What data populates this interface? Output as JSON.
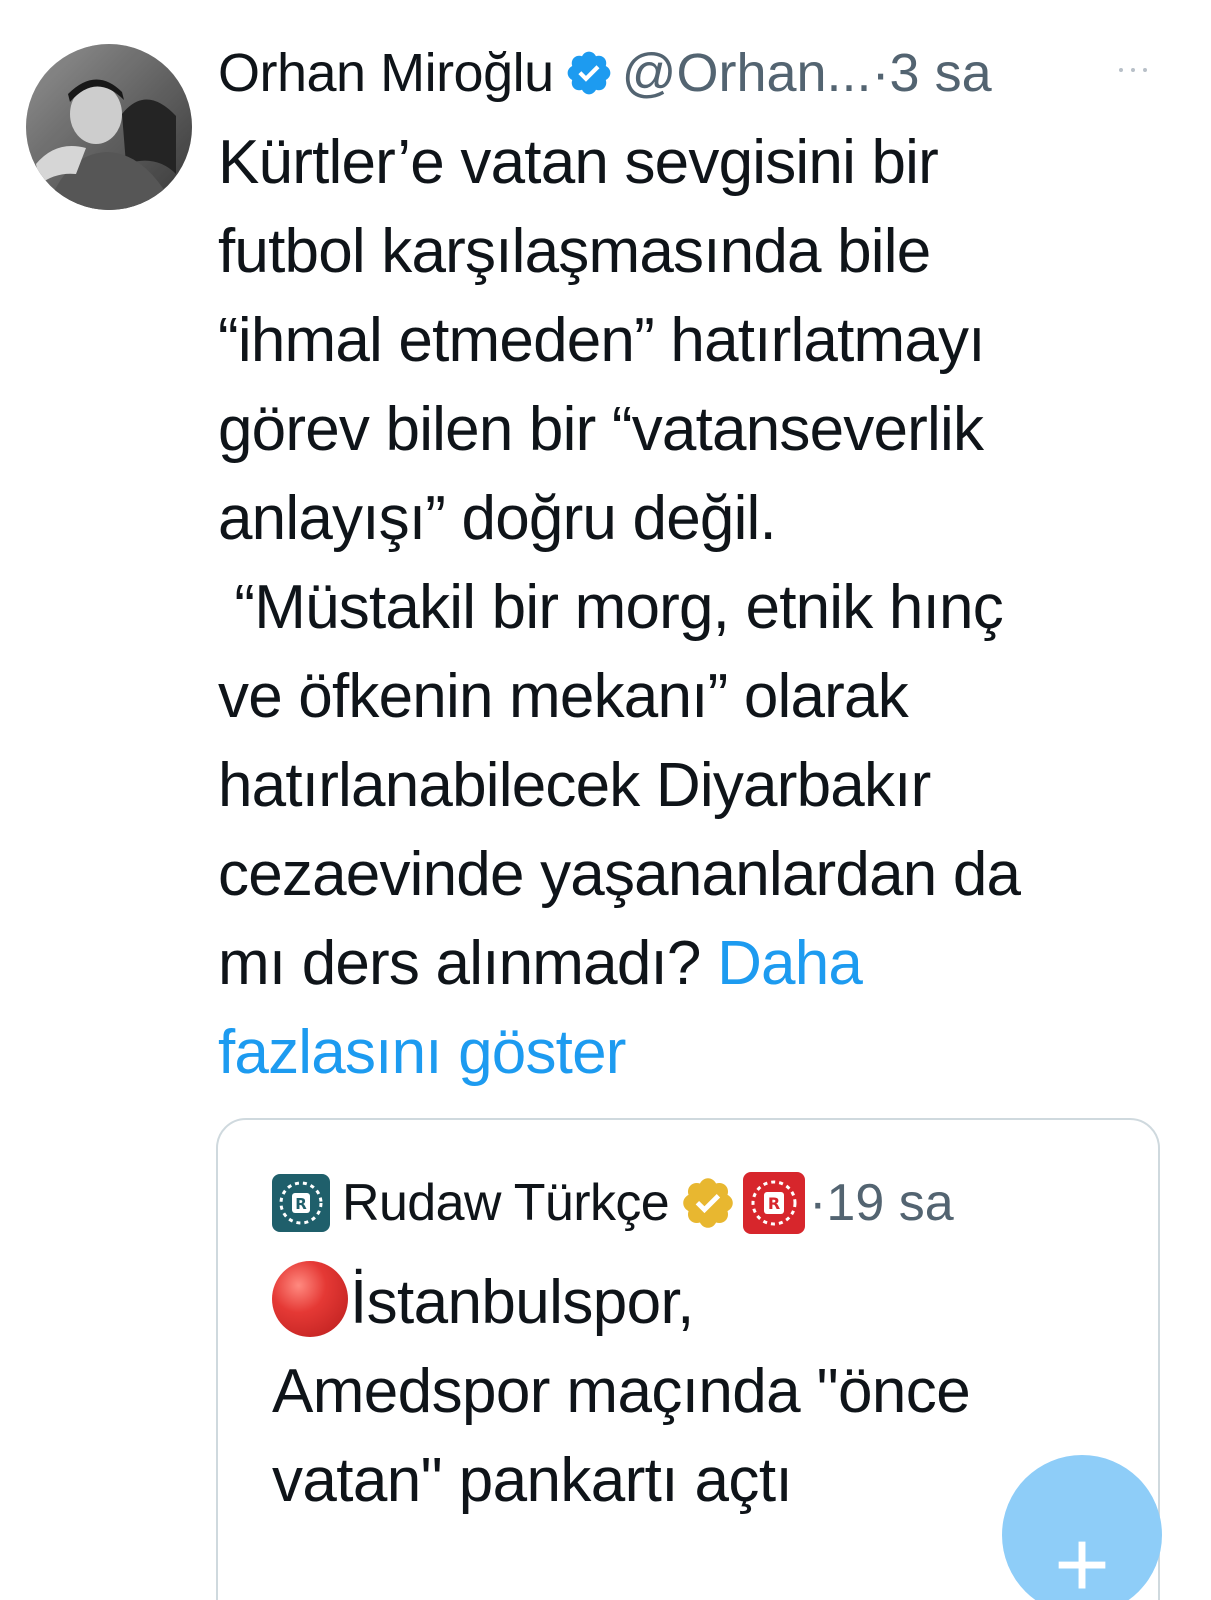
{
  "tweet": {
    "author_name": "Orhan Miroğlu",
    "handle": "@Orhan...",
    "separator": "·",
    "time": "3 sa",
    "lines": [
      "Kürtler’e vatan sevgisini bir",
      "futbol karşılaşmasında bile",
      "“ihmal etmeden” hatırlatmayı",
      "görev bilen bir “vatanseverlik",
      "anlayışı” doğru değil.",
      " “Müstakil bir morg, etnik hınç",
      "ve öfkenin mekanı” olarak",
      "hatırlanabilecek Diyarbakır",
      "cezaevinde yaşananlardan da",
      "mı ders alınmadı?"
    ],
    "show_more_part1": "Daha",
    "show_more_part2": "fazlasını göster"
  },
  "quoted_tweet": {
    "author_name": "Rudaw Türkçe",
    "separator": "·",
    "time": "19 sa",
    "lines": [
      "İstanbulspor,",
      "Amedspor maçında \"önce",
      "vatan\" pankartı açtı"
    ]
  },
  "fab": {
    "label": "+"
  },
  "colors": {
    "text": "#0f1419",
    "secondary": "#536471",
    "link": "#1d9bf0",
    "verified_blue": "#1d9bf0",
    "verified_gold": "#e8b730",
    "fab": "#8ecdf8",
    "rudaw_red": "#d7262c",
    "rudaw_teal": "#1f5f6b"
  }
}
